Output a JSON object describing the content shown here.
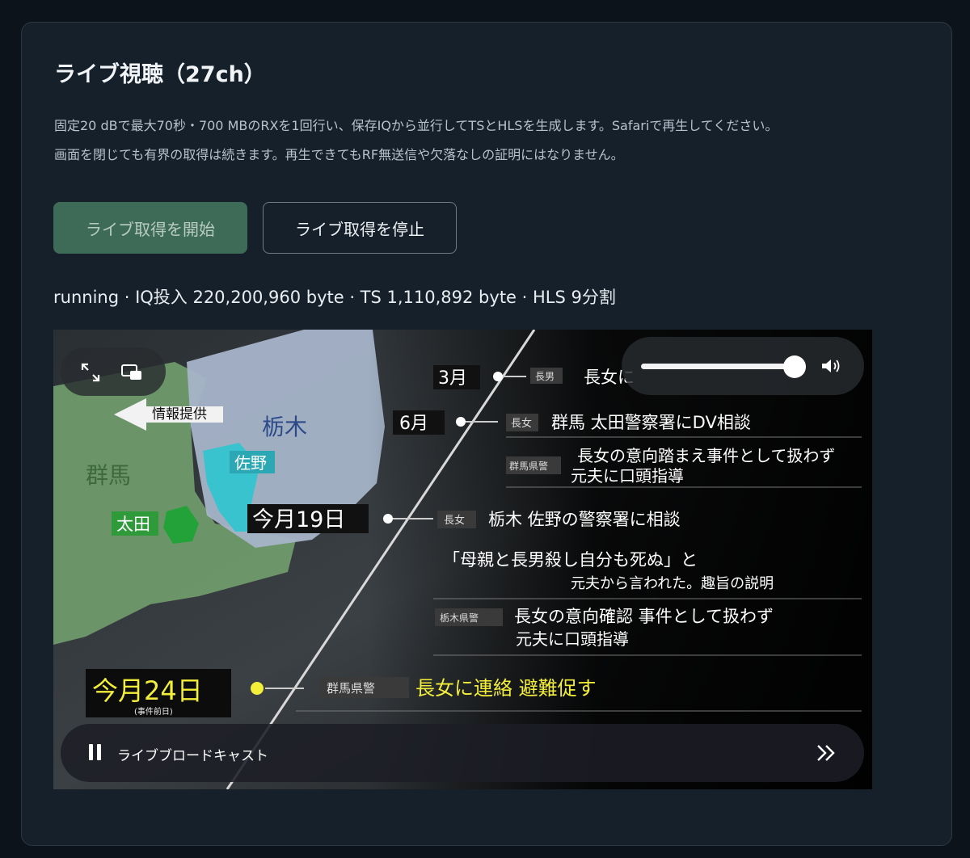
{
  "card": {
    "title": "ライブ視聴（27ch）",
    "description_lines": [
      "固定20 dBで最大70秒・700 MBのRXを1回行い、保存IQから並行してTSとHLSを生成します。Safariで再生してください。",
      "画面を閉じても有界の取得は続きます。再生できてもRF無送信や欠落なしの証明にはなりません。"
    ],
    "buttons": {
      "start_label": "ライブ取得を開始",
      "stop_label": "ライブ取得を停止"
    },
    "status_text": "running · IQ投入 220,200,960 byte · TS 1,110,892 byte · HLS 9分割"
  },
  "player": {
    "volume_level": 0.95,
    "now_playing": "ライブブロードキャスト",
    "icons": {
      "fullscreen": "expand-icon",
      "pip": "picture-in-picture-icon",
      "volume": "speaker-icon",
      "pause": "pause-icon",
      "skip": "skip-forward-icon"
    },
    "frame": {
      "map_labels": [
        "情報提供",
        "栃木",
        "群馬",
        "佐野",
        "太田"
      ],
      "timeline": [
        {
          "date": "3月",
          "tag": "長男",
          "text": "長女に"
        },
        {
          "date": "6月",
          "tag": "長女",
          "text": "群馬 太田警察署にDV相談"
        },
        {
          "date": "",
          "tag": "群馬県警",
          "text": "長女の意向踏まえ事件として扱わず",
          "sub": "元夫に口頭指導"
        },
        {
          "date": "今月19日",
          "tag": "長女",
          "text": "栃木 佐野の警察署に相談"
        },
        {
          "date": "",
          "tag": "",
          "text": "「母親と長男殺し自分も死ぬ」と",
          "sub": "元夫から言われた。趣旨の説明"
        },
        {
          "date": "",
          "tag": "栃木県警",
          "text": "長女の意向確認 事件として扱わず",
          "sub": "元夫に口頭指導"
        },
        {
          "date": "今月24日",
          "date_sub": "(事件前日)",
          "tag": "群馬県警",
          "text": "長女に連絡 避難促す"
        }
      ]
    }
  }
}
